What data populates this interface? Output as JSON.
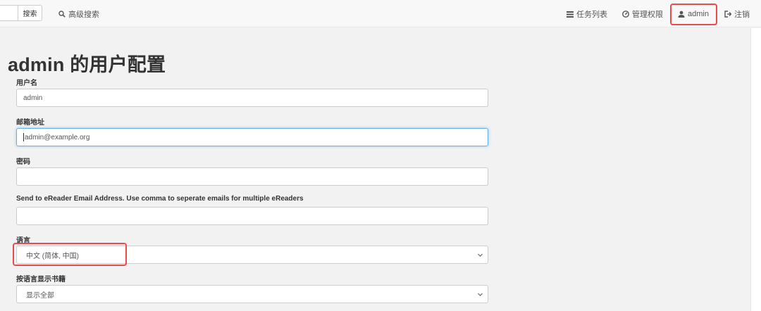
{
  "navbar": {
    "search_button": "搜索",
    "advanced_search": "高级搜索",
    "task_list": "任务列表",
    "admin_panel": "管理权限",
    "user": "admin",
    "logout": "注销"
  },
  "page": {
    "title": "admin 的用户配置"
  },
  "form": {
    "username_label": "用户名",
    "username_value": "admin",
    "email_label": "邮箱地址",
    "email_value": "admin@example.org",
    "password_label": "密码",
    "password_value": "",
    "kindle_label": "Send to eReader Email Address. Use comma to seperate emails for multiple eReaders",
    "kindle_value": "",
    "language_label": "语言",
    "language_value": "中文 (简体, 中国)",
    "books_language_label": "按语言显示书籍",
    "books_language_value": "显示全部"
  },
  "colors": {
    "highlight": "#e84c4c",
    "focus": "#66afe9"
  }
}
